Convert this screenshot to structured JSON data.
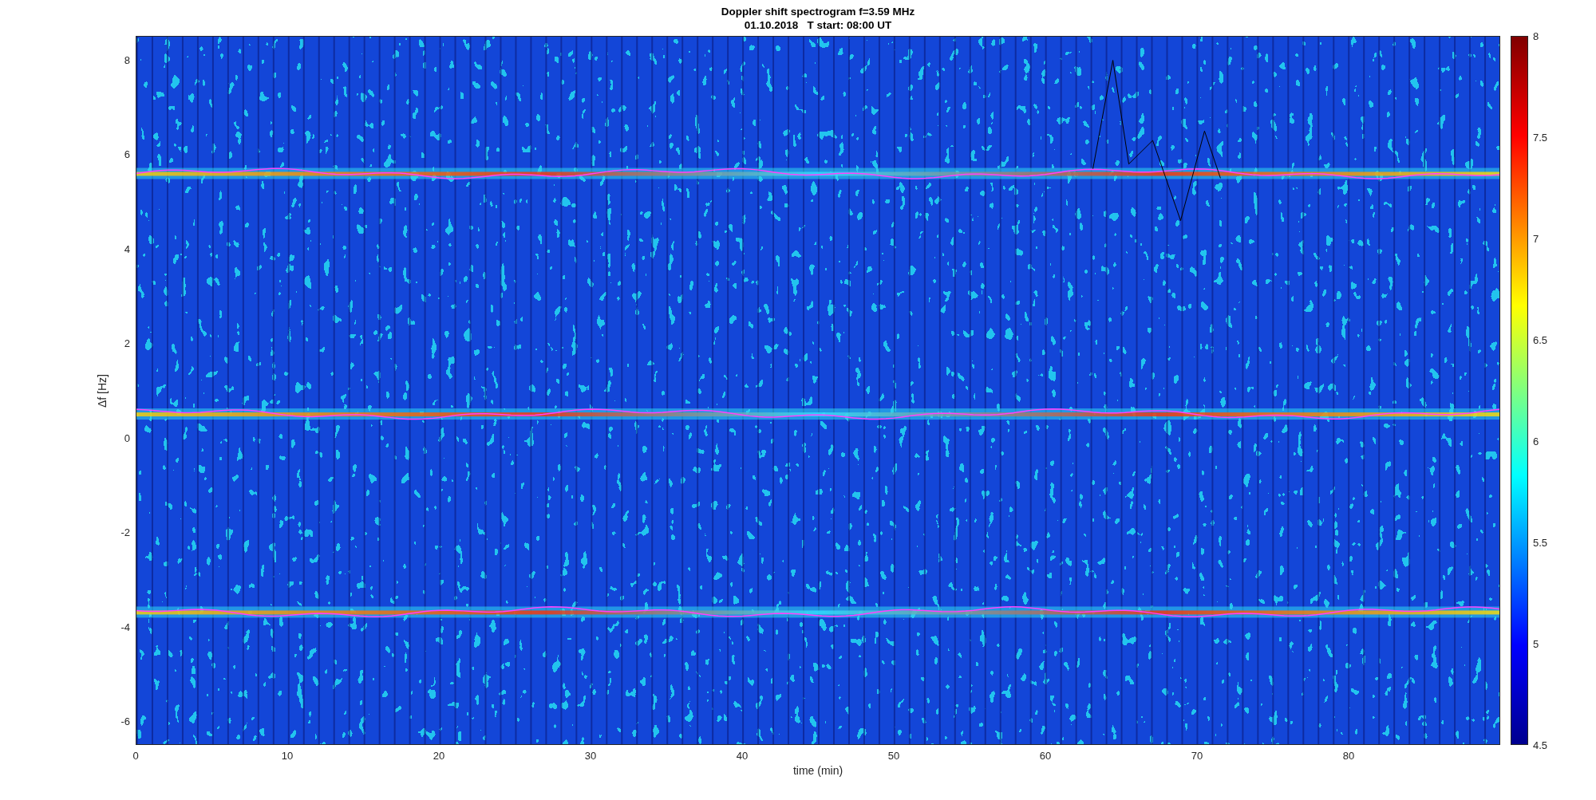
{
  "title": [
    "Doppler shift spectrogram f=3.59 MHz",
    "01.10.2018   T start: 08:00 UT"
  ],
  "ylabel": "Δf [Hz]",
  "xlabel": "time (min)",
  "y_ticks": [
    "8",
    "6",
    "4",
    "2",
    "0",
    "-2",
    "-4",
    "-6"
  ],
  "x_ticks": [
    "0",
    "10",
    "20",
    "30",
    "40",
    "50",
    "60",
    "70",
    "80"
  ],
  "colorbar_ticks": [
    "8",
    "7.5",
    "7",
    "6.5",
    "6",
    "5.5",
    "5",
    "4.5"
  ]
}
